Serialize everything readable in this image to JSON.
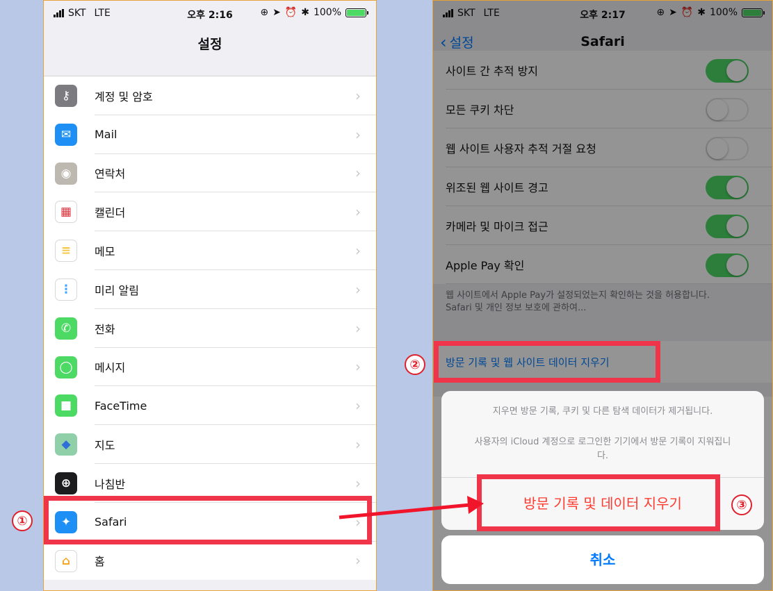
{
  "colors": {
    "accent": "#007aff",
    "destructive": "#ff3b30",
    "toggle_on": "#4cd964",
    "highlight": "#f0354a"
  },
  "left": {
    "status": {
      "carrier": "SKT",
      "network": "LTE",
      "time": "오후 2:16",
      "battery": "100%",
      "battery_level": 1.0
    },
    "title": "설정",
    "items": [
      {
        "label": "계정 및 암호",
        "icon": "key-icon"
      },
      {
        "label": "Mail",
        "icon": "mail-icon"
      },
      {
        "label": "연락처",
        "icon": "contacts-icon"
      },
      {
        "label": "캘린더",
        "icon": "calendar-icon"
      },
      {
        "label": "메모",
        "icon": "notes-icon"
      },
      {
        "label": "미리 알림",
        "icon": "reminders-icon"
      },
      {
        "label": "전화",
        "icon": "phone-icon"
      },
      {
        "label": "메시지",
        "icon": "messages-icon"
      },
      {
        "label": "FaceTime",
        "icon": "facetime-icon"
      },
      {
        "label": "지도",
        "icon": "maps-icon"
      },
      {
        "label": "나침반",
        "icon": "compass-icon"
      },
      {
        "label": "Safari",
        "icon": "safari-icon"
      },
      {
        "label": "홈",
        "icon": "home-icon"
      }
    ]
  },
  "right": {
    "status": {
      "carrier": "SKT",
      "network": "LTE",
      "time": "오후 2:17",
      "battery": "100%",
      "battery_level": 1.0
    },
    "back_label": "설정",
    "title": "Safari",
    "settings": [
      {
        "label": "사이트 간 추적 방지",
        "on": true
      },
      {
        "label": "모든 쿠키 차단",
        "on": false
      },
      {
        "label": "웹 사이트 사용자 추적 거절 요청",
        "on": false
      },
      {
        "label": "위조된 웹 사이트 경고",
        "on": true
      },
      {
        "label": "카메라 및 마이크 접근",
        "on": true
      },
      {
        "label": "Apple Pay 확인",
        "on": true
      }
    ],
    "footnote_line1": "웹 사이트에서 Apple Pay가 설정되었는지 확인하는 것을 허용합니다.",
    "footnote_line2": "Safari 및 개인 정보 보호에 관하여...",
    "clear_history_link": "방문 기록 및 웹 사이트 데이터 지우기",
    "sheet": {
      "message1": "지우면 방문 기록, 쿠키 및 다른 탐색 데이터가 제거됩니다.",
      "message2": "사용자의 iCloud 계정으로 로그인한 기기에서 방문 기록이 지워집니다.",
      "confirm": "방문 기록 및 데이터 지우기",
      "cancel": "취소"
    }
  },
  "annotations": {
    "step1": "①",
    "step2": "②",
    "step3": "③"
  }
}
